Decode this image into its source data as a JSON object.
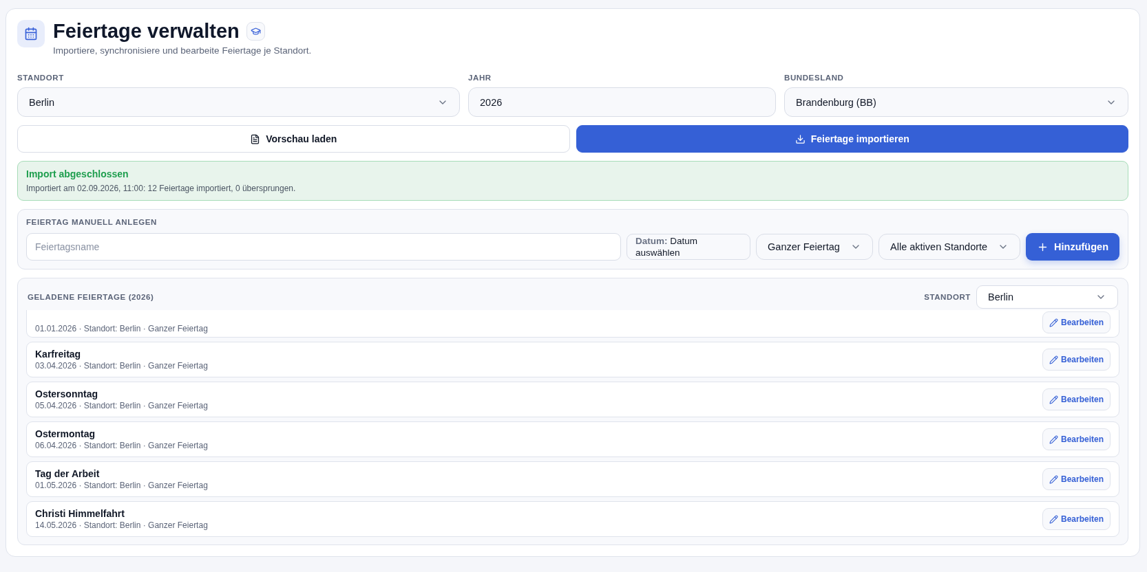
{
  "header": {
    "title": "Feiertage verwalten",
    "subtitle": "Importiere, synchronisiere und bearbeite Feiertage je Standort."
  },
  "filters": [
    {
      "kind": "select",
      "label": "STANDORT",
      "value": "Berlin"
    },
    {
      "kind": "input",
      "label": "JAHR",
      "value": "2026"
    },
    {
      "kind": "select",
      "label": "BUNDESLAND",
      "value": "Brandenburg (BB)"
    }
  ],
  "actions": [
    {
      "kind": "secondary",
      "label": "Vorschau laden"
    },
    {
      "kind": "primary",
      "label": "Feiertage importieren"
    }
  ],
  "alert": {
    "title": "Import abgeschlossen",
    "message": "Importiert am 02.09.2026, 11:00: 12 Feiertage importiert, 0 übersprungen."
  },
  "manual": {
    "heading": "FEIERTAG MANUELL ANLEGEN",
    "name_placeholder": "Feiertagsname",
    "date_label": "Datum:",
    "date_value": "Datum auswählen",
    "type_value": "Ganzer Feiertag",
    "location_value": "Alle aktiven Standorte",
    "add_label": "Hinzufügen"
  },
  "holidays": {
    "heading": "GELADENE FEIERTAGE (2026)",
    "filter_label": "STANDORT",
    "filter_value": "Berlin",
    "rows": [
      {
        "meta": "01.01.2026 · Standort: Berlin · Ganzer Feiertag",
        "edit_label": "Bearbeiten"
      },
      {
        "title": "Karfreitag",
        "meta": "03.04.2026 · Standort: Berlin · Ganzer Feiertag",
        "edit_label": "Bearbeiten"
      },
      {
        "title": "Ostersonntag",
        "meta": "05.04.2026 · Standort: Berlin · Ganzer Feiertag",
        "edit_label": "Bearbeiten"
      },
      {
        "title": "Ostermontag",
        "meta": "06.04.2026 · Standort: Berlin · Ganzer Feiertag",
        "edit_label": "Bearbeiten"
      },
      {
        "title": "Tag der Arbeit",
        "meta": "01.05.2026 · Standort: Berlin · Ganzer Feiertag",
        "edit_label": "Bearbeiten"
      },
      {
        "title": "Christi Himmelfahrt",
        "meta": "14.05.2026 · Standort: Berlin · Ganzer Feiertag",
        "edit_label": "Bearbeiten"
      }
    ]
  }
}
